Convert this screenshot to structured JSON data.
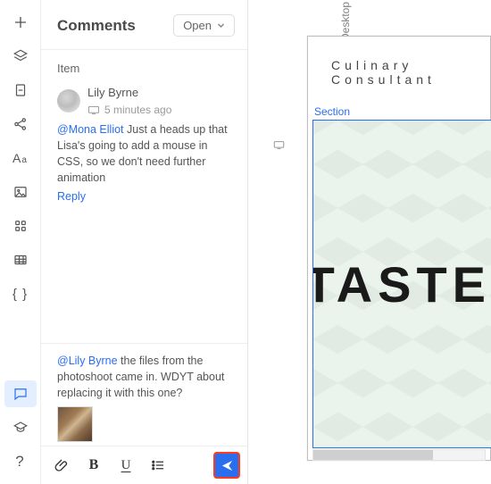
{
  "panel": {
    "title": "Comments",
    "filter_label": "Open",
    "item_label": "Item",
    "comment": {
      "author": "Lily Byrne",
      "time": "5 minutes ago",
      "mention": "@Mona Elliot",
      "body_rest": " Just a heads up that Lisa's going to add a mouse in CSS, so we don't need further animation",
      "reply": "Reply"
    }
  },
  "composer": {
    "mention": "@Lily Byrne",
    "draft_rest": "   the files from the photoshoot came in. WDYT about replacing it with this one?"
  },
  "canvas": {
    "viewport_label": "Desktop (Primary)",
    "page_title": "Culinary Consultant",
    "section_label": "Section",
    "hero_text": "TASTE"
  }
}
